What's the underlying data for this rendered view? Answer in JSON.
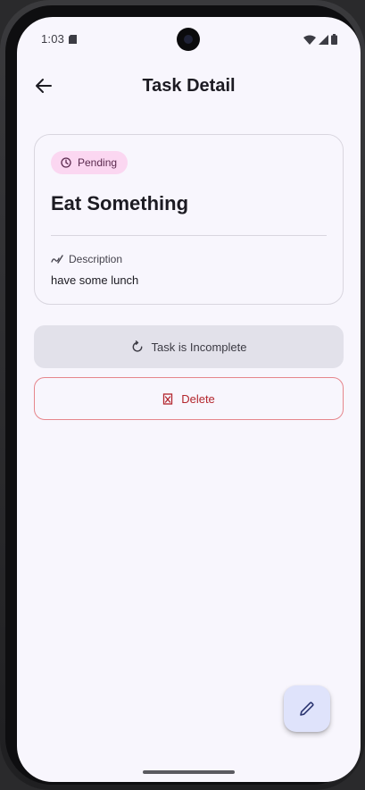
{
  "status_bar": {
    "time": "1:03",
    "icons": [
      "sd-card-icon",
      "wifi-icon",
      "signal-icon",
      "battery-icon"
    ]
  },
  "app_bar": {
    "title": "Task Detail",
    "back_icon": "arrow-back-icon"
  },
  "task": {
    "status_badge": "Pending",
    "status_icon": "clock-icon",
    "title": "Eat Something",
    "description_label": "Description",
    "description_icon": "pen-scribble-icon",
    "description": "have some lunch"
  },
  "actions": {
    "toggle_label": "Task is Incomplete",
    "toggle_icon": "refresh-icon",
    "delete_label": "Delete",
    "delete_icon": "trash-icon"
  },
  "fab": {
    "icon": "edit-pencil-icon"
  },
  "colors": {
    "background": "#f8f6fd",
    "badge_bg": "#fbd7f1",
    "delete_red": "#b3262d",
    "delete_border": "#e6868c",
    "secondary_button": "#e2e1ea",
    "fab_bg": "#dfe3fb"
  }
}
